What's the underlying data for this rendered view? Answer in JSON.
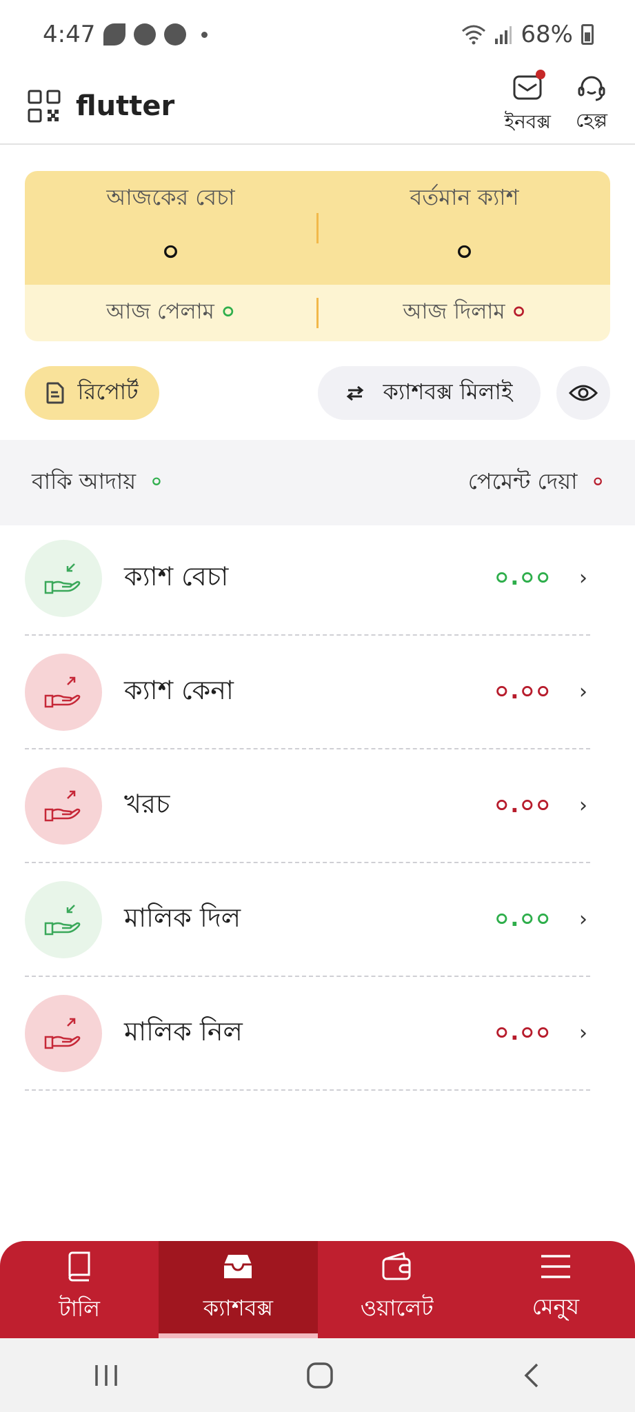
{
  "status_bar": {
    "time": "4:47",
    "battery": "68%",
    "icons": [
      "leaf-icon",
      "messenger-icon",
      "ghost-app-icon",
      "notification-dot-icon",
      "wifi-icon",
      "signal-icon",
      "battery-icon"
    ]
  },
  "app_bar": {
    "title": "flutter",
    "inbox_label": "ইনবক্স",
    "help_label": "হেল্প"
  },
  "summary": {
    "today_sales_label": "আজকের বেচা",
    "today_sales_value": "০",
    "current_cash_label": "বর্তমান ক্যাশ",
    "current_cash_value": "০",
    "received_label": "আজ পেলাম",
    "received_value": "০",
    "given_label": "আজ দিলাম",
    "given_value": "০"
  },
  "actions": {
    "report_label": "রিপোর্ট",
    "tally_label": "ক্যাশবক্স মিলাই"
  },
  "dues": {
    "collect_label": "বাকি আদায়",
    "collect_value": "০",
    "payment_label": "পেমেন্ট দেয়া",
    "payment_value": "০"
  },
  "transactions": [
    {
      "label": "ক্যাশ বেচা",
      "amount": "০.০০",
      "direction": "in"
    },
    {
      "label": "ক্যাশ কেনা",
      "amount": "০.০০",
      "direction": "out"
    },
    {
      "label": "খরচ",
      "amount": "০.০০",
      "direction": "out"
    },
    {
      "label": "মালিক দিল",
      "amount": "০.০০",
      "direction": "in"
    },
    {
      "label": "মালিক নিল",
      "amount": "০.০০",
      "direction": "out"
    }
  ],
  "bottom_nav": {
    "tally": "টালি",
    "cashbox": "ক্যাশবক্স",
    "wallet": "ওয়ালেট",
    "menu": "মেনু্য"
  },
  "colors": {
    "brand_red": "#bf1f2f",
    "summary_yellow": "#f9e29a",
    "green": "#2eae4b",
    "red": "#b71c2c"
  }
}
